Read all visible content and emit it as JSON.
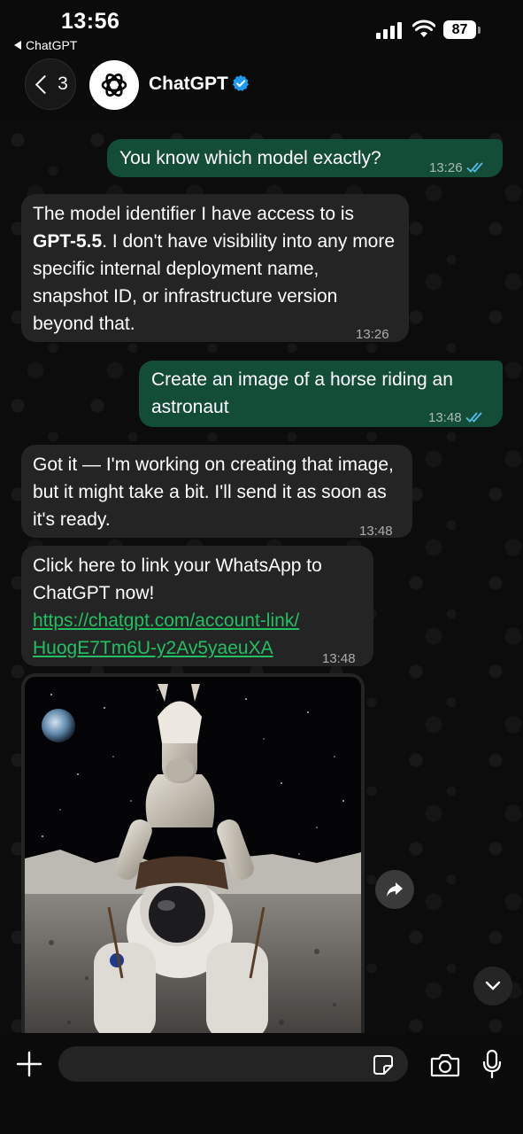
{
  "status_bar": {
    "time": "13:56",
    "back_app": "ChatGPT",
    "battery": "87"
  },
  "header": {
    "back_count": "3",
    "contact_name": "ChatGPT",
    "verified_icon": "verified-badge-icon",
    "accent_color": "#1d9bf0"
  },
  "messages": [
    {
      "direction": "outgoing",
      "text": "You know which model exactly?",
      "time": "13:26",
      "status": "read"
    },
    {
      "direction": "incoming",
      "text_before_bold": "The model identifier I have access to is ",
      "bold": "GPT-5.5",
      "text_after_bold": ". I don't have visibility into any more specific internal deployment name, snapshot ID, or infrastructure version beyond that.",
      "time": "13:26"
    },
    {
      "direction": "outgoing",
      "text": "Create an image of a horse riding an astronaut",
      "time": "13:48",
      "status": "read"
    },
    {
      "direction": "incoming",
      "text": "Got it — I'm working on creating that image, but it might take a bit. I'll send it as soon as it's ready.",
      "time": "13:48"
    },
    {
      "direction": "incoming",
      "text": "Click here to link your WhatsApp to ChatGPT now!",
      "link": "https://chatgpt.com/account-link/HuogE7Tm6U-y2Av5yaeuXA",
      "link_line1": "https://chatgpt.com/account-link/",
      "link_line2": "HuogE7Tm6U-y2Av5yaeuXA",
      "time": "13:48"
    },
    {
      "direction": "incoming",
      "type": "image",
      "image_label": "horse-riding-astronaut-image"
    }
  ],
  "composer": {
    "placeholder": ""
  },
  "colors": {
    "outgoing_bubble": "#144d37",
    "incoming_bubble": "#242424",
    "link": "#21c063",
    "read_ticks": "#53bdeb"
  }
}
